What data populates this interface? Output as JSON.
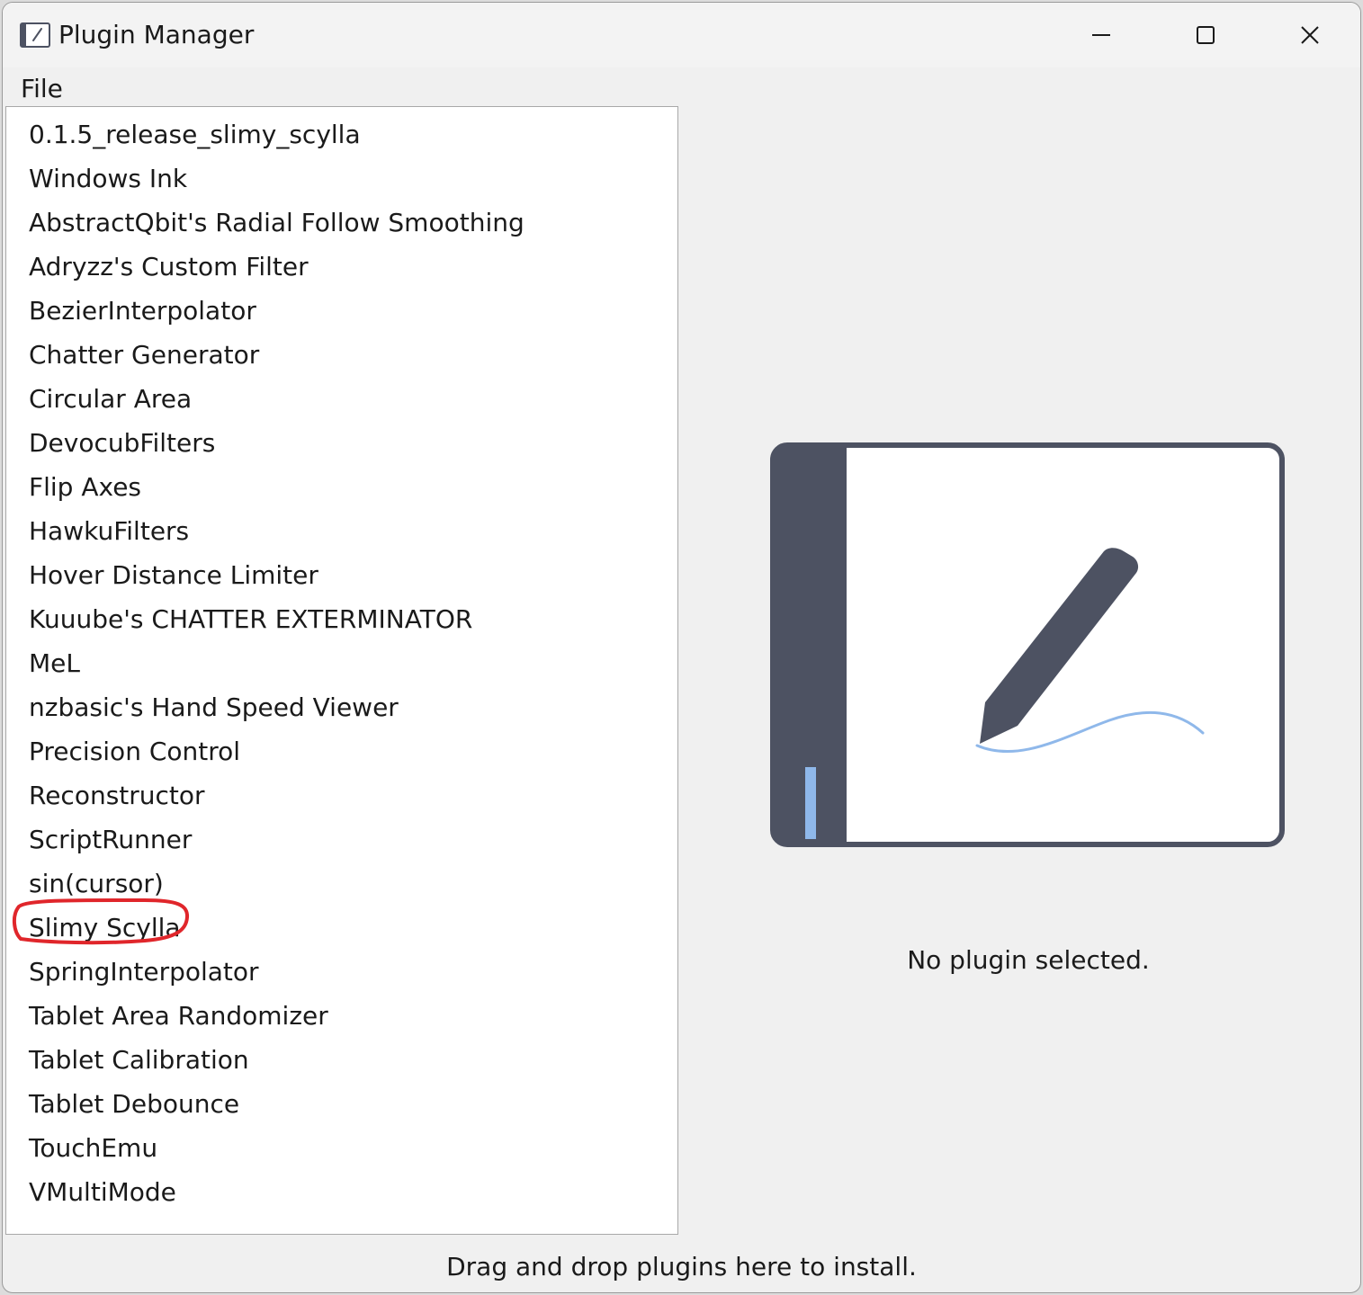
{
  "window": {
    "title": "Plugin Manager",
    "icons": {
      "app": "tablet-pen-icon",
      "minimize": "minimize-icon",
      "maximize": "maximize-icon",
      "close": "close-icon"
    }
  },
  "menu": {
    "file_label": "File"
  },
  "plugins": {
    "items": [
      "0.1.5_release_slimy_scylla",
      "Windows Ink",
      "AbstractQbit's Radial Follow Smoothing",
      "Adryzz's Custom Filter",
      "BezierInterpolator",
      "Chatter Generator",
      "Circular Area",
      "DevocubFilters",
      "Flip Axes",
      "HawkuFilters",
      "Hover Distance Limiter",
      "Kuuube's CHATTER EXTERMINATOR",
      "MeL",
      "nzbasic's Hand Speed Viewer",
      "Precision Control",
      "Reconstructor",
      "ScriptRunner",
      "sin(cursor)",
      "Slimy Scylla",
      "SpringInterpolator",
      "Tablet Area Randomizer",
      "Tablet Calibration",
      "Tablet Debounce",
      "TouchEmu",
      "VMultiMode"
    ],
    "annotated_item": "Slimy Scylla"
  },
  "details": {
    "empty_message": "No plugin selected.",
    "illustration": "tablet-with-pen-illustration"
  },
  "status": {
    "drop_hint": "Drag and drop plugins here to install."
  },
  "colors": {
    "window_bg": "#f0f0f0",
    "list_bg": "#ffffff",
    "tablet_dark": "#4d5262",
    "stroke_blue": "#8fb8ea",
    "annotation_red": "#e0262b"
  }
}
